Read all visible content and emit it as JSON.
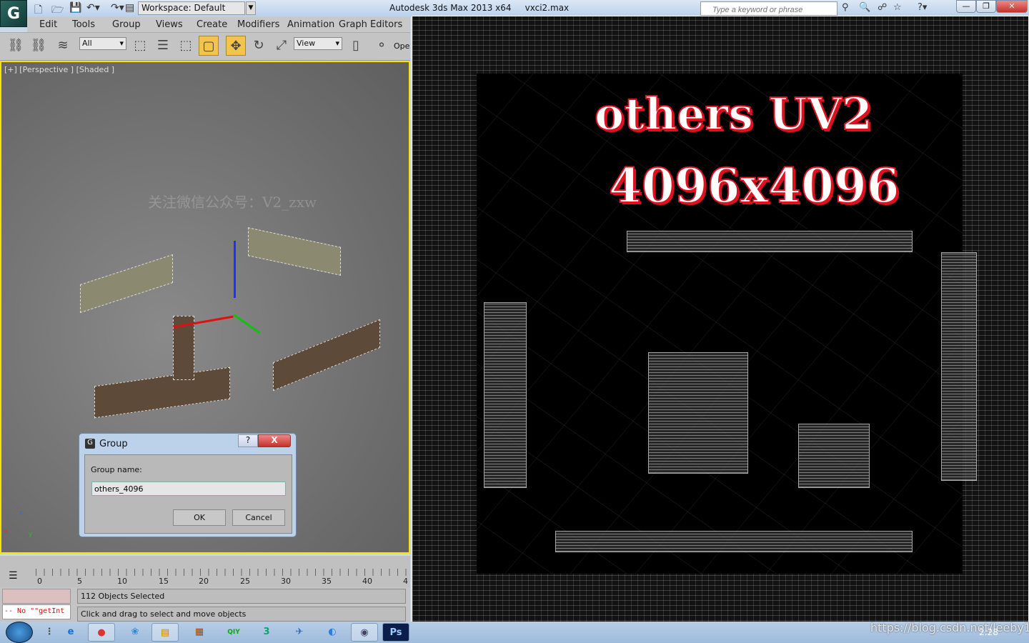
{
  "titlebar": {
    "workspace": "Workspace: Default",
    "app_title": "Autodesk 3ds Max  2013 x64",
    "file_name": "vxci2.max",
    "search_placeholder": "Type a keyword or phrase"
  },
  "menu": [
    "Edit",
    "Tools",
    "Group",
    "Views",
    "Create",
    "Modifiers",
    "Animation",
    "Graph Editors"
  ],
  "toolbar": {
    "selection_filter": "All",
    "ref_coord": "View",
    "open_label": "Ope"
  },
  "viewport": {
    "label": "[+] [Perspective ] [Shaded ]",
    "watermark": "关注微信公众号：V2_zxw",
    "axis_x": "x",
    "axis_y": "y",
    "axis_z": "z"
  },
  "dialog": {
    "title": "Group",
    "help": "?",
    "close": "X",
    "group_name_label": "Group name:",
    "group_name_value": "others_4096",
    "ok": "OK",
    "cancel": "Cancel"
  },
  "timeline": {
    "ticks": [
      "0",
      "5",
      "10",
      "15",
      "20",
      "25",
      "30",
      "35",
      "40",
      "4"
    ]
  },
  "status": {
    "selection": "112 Objects Selected",
    "prompt": "Click and drag to select and move objects",
    "maxscript": "-- No \"\"getInt"
  },
  "uv_view": {
    "line1": "others UV2",
    "line2": "4096x4096"
  },
  "taskbar": {
    "apps": [
      "e",
      "●",
      "❀",
      "▤",
      "▦",
      "QIY",
      "3",
      "✈",
      "◐",
      "◉",
      "Ps"
    ],
    "clock": "2:28"
  },
  "watermark": "https://blog.csdn.net/leeby100",
  "colors": {
    "viewport_border": "#f5e400",
    "active_tool": "#f3c44b",
    "uv_text_outline": "#e01020"
  }
}
